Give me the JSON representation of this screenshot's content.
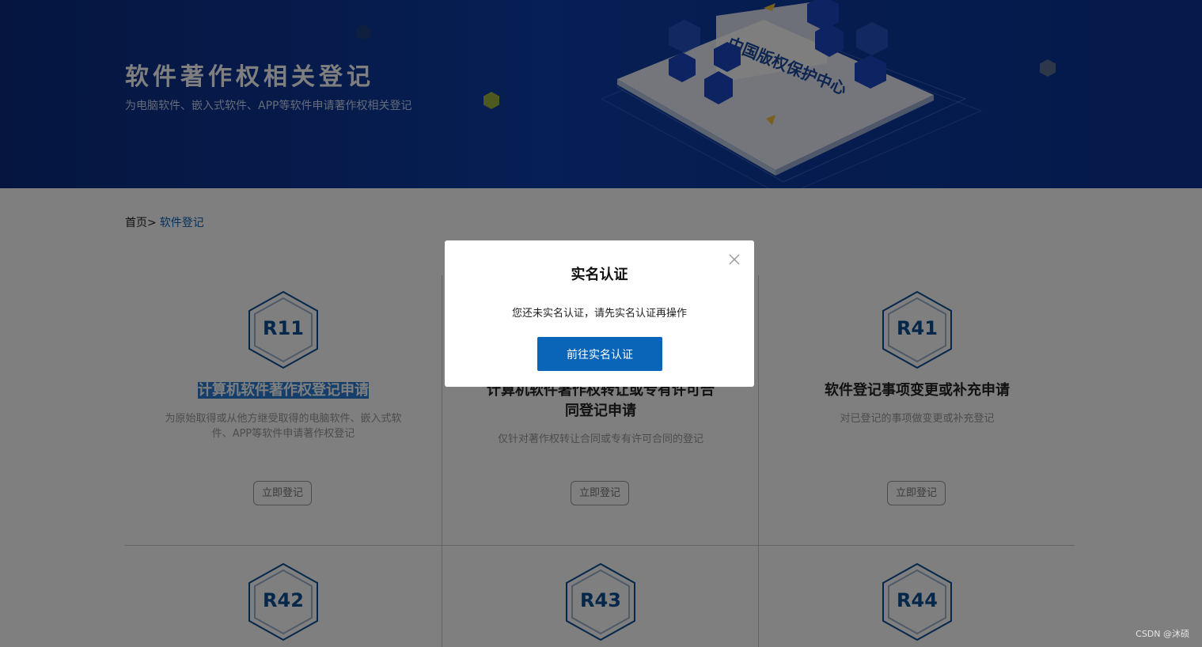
{
  "banner": {
    "title": "软件著作权相关登记",
    "subtitle": "为电脑软件、嵌入式软件、APP等软件申请著作权相关登记",
    "logo_text": "中国版权保护中心"
  },
  "breadcrumb": {
    "home": "首页>",
    "current": "软件登记"
  },
  "cards": [
    {
      "code": "R11",
      "title": "计算机软件著作权登记申请",
      "description": "为原始取得或从他方继受取得的电脑软件、嵌入式软件、APP等软件申请著作权登记",
      "button": "立即登记",
      "title_selected": true
    },
    {
      "code": "",
      "title": "计算机软件著作权转让或专有许可合同登记申请",
      "description": "仅针对著作权转让合同或专有许可合同的登记",
      "button": "立即登记"
    },
    {
      "code": "R41",
      "title": "软件登记事项变更或补充申请",
      "description": "对已登记的事项做变更或补充登记",
      "button": "立即登记"
    },
    {
      "code": "R42"
    },
    {
      "code": "R43"
    },
    {
      "code": "R44"
    }
  ],
  "modal": {
    "title": "实名认证",
    "message": "您还未实名认证，请先实名认证再操作",
    "button": "前往实名认证",
    "close_icon": "close-icon"
  },
  "watermark": "CSDN @沐硕",
  "colors": {
    "banner_blue": "#0d3ea8",
    "accent_blue": "#0a64b7",
    "hex_blue": "#0a4f95"
  }
}
